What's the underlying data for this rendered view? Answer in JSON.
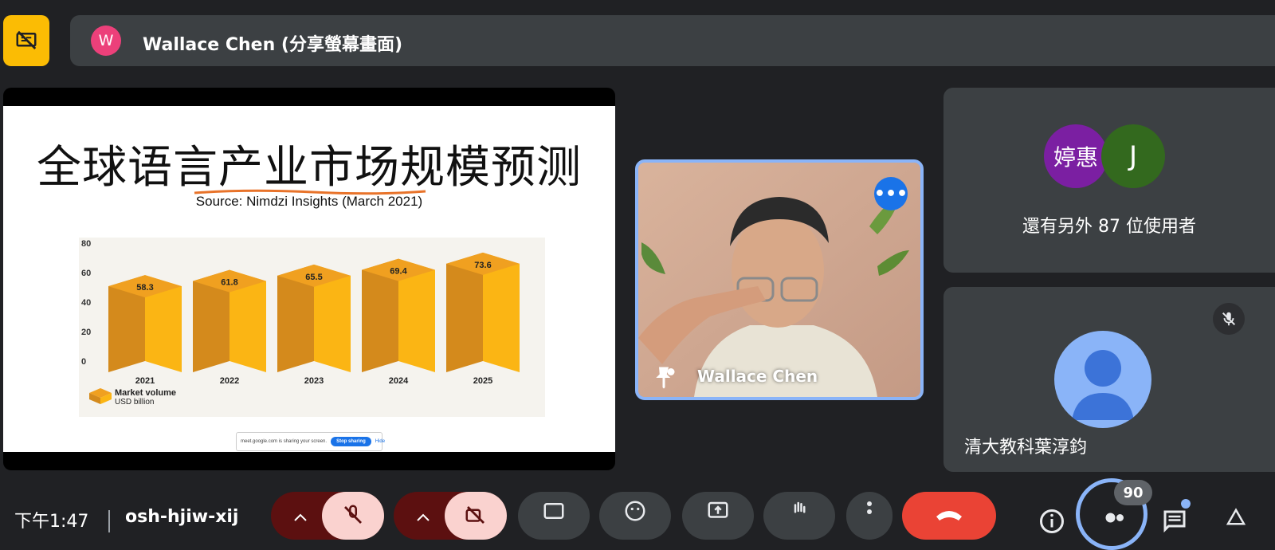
{
  "banner": {
    "avatar_letter": "W",
    "title": "Wallace Chen (分享螢幕畫面)"
  },
  "slide": {
    "title": "全球语言产业市场规模预测",
    "source": "Source: Nimdzi Insights (March 2021)",
    "sharing_text": "meet.google.com is sharing your screen.",
    "stop_label": "Stop sharing",
    "hide_label": "Hide"
  },
  "chart_data": {
    "type": "bar",
    "categories": [
      "2021",
      "2022",
      "2023",
      "2024",
      "2025"
    ],
    "values": [
      58.3,
      61.8,
      65.5,
      69.4,
      73.6
    ],
    "value_labels": [
      "58.3",
      "61.8",
      "65.5",
      "69.4",
      "73.6"
    ],
    "yticks": [
      "80",
      "60",
      "40",
      "20",
      "0"
    ],
    "ylim": [
      0,
      80
    ],
    "legend": [
      "Market volume",
      "USD billion"
    ],
    "colors": {
      "front": "#fbb514",
      "side": "#d48a1c",
      "top": "#f0a020"
    }
  },
  "speaker": {
    "name": "Wallace Chen",
    "more_glyph": "•••"
  },
  "others": {
    "avatar1": "婷惠",
    "avatar1_color": "#7b1fa2",
    "avatar2": "J",
    "avatar2_color": "#33691e",
    "text": "還有另外 87 位使用者"
  },
  "person": {
    "name": "清大教科葉淳鈞"
  },
  "bottom": {
    "clock": "下午1:47",
    "meeting_code": "osh-hjiw-xij",
    "participants_count": "90"
  }
}
